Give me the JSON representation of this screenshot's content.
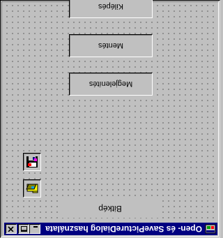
{
  "window": {
    "title": "Open- és SavePictureDialog használata"
  },
  "buttons": {
    "exit_label": "Kilépés",
    "save_label": "Mentés",
    "view_label": "Megjelenítés",
    "image_label": "Bitkép"
  },
  "icons": {
    "app": "app-icon",
    "save": "floppy-disk-icon",
    "open": "open-folder-icon",
    "minimize": "minimize-icon",
    "maximize": "maximize-icon",
    "close": "close-icon"
  },
  "colors": {
    "title_bar": "#000080",
    "face": "#c0c0c0"
  }
}
